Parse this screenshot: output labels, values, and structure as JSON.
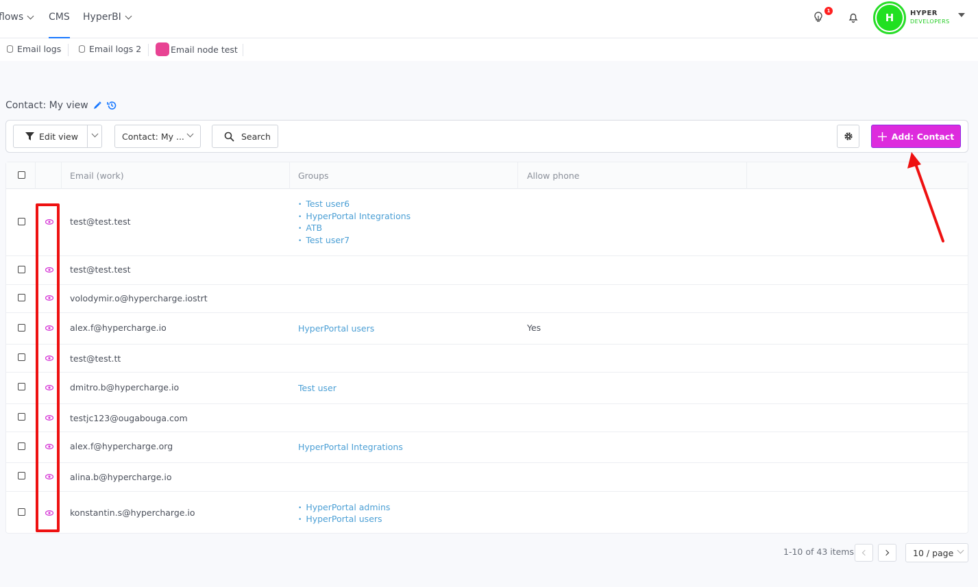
{
  "nav": {
    "items": [
      {
        "label": "flows"
      },
      {
        "label": "CMS"
      },
      {
        "label": "HyperBI"
      }
    ],
    "notification_count": "1",
    "user": {
      "initial": "H",
      "brand_top": "HYPER",
      "brand_bottom": "DEVELOPERS"
    }
  },
  "tabs": [
    {
      "label": "Email logs"
    },
    {
      "label": "Email logs 2"
    },
    {
      "label": "Email node test"
    }
  ],
  "view": {
    "title": "Contact: My view"
  },
  "toolbar": {
    "edit_view_label": "Edit view",
    "view_select_label": "Contact: My ...",
    "search_label": "Search",
    "add_label": "Add: Contact"
  },
  "table": {
    "columns": [
      "Email (work)",
      "Groups",
      "Allow phone"
    ],
    "rows": [
      {
        "email": "test@test.test",
        "groups": [
          "Test user6",
          "HyperPortal Integrations",
          "ATB",
          "Test user7"
        ],
        "phone": ""
      },
      {
        "email": "test@test.test",
        "groups": [],
        "phone": ""
      },
      {
        "email": "volodymir.o@hypercharge.iostrt",
        "groups": [],
        "phone": ""
      },
      {
        "email": "alex.f@hypercharge.io",
        "groups": [
          "HyperPortal users"
        ],
        "phone": "Yes"
      },
      {
        "email": "test@test.tt",
        "groups": [],
        "phone": ""
      },
      {
        "email": "dmitro.b@hypercharge.io",
        "groups": [
          "Test user"
        ],
        "phone": ""
      },
      {
        "email": "testjc123@ougabouga.com",
        "groups": [],
        "phone": ""
      },
      {
        "email": "alex.f@hypercharge.org",
        "groups": [
          "HyperPortal Integrations"
        ],
        "phone": ""
      },
      {
        "email": "alina.b@hypercharge.io",
        "groups": [],
        "phone": ""
      },
      {
        "email": "konstantin.s@hypercharge.io",
        "groups": [
          "HyperPortal admins",
          "HyperPortal users"
        ],
        "phone": ""
      }
    ]
  },
  "pagination": {
    "info": "1-10 of 43 items",
    "page_size": "10 / page"
  },
  "colors": {
    "accent": "#dd2bdd",
    "link": "#4b9fd5",
    "highlight": "#ee1111",
    "avatar": "#21e021"
  }
}
